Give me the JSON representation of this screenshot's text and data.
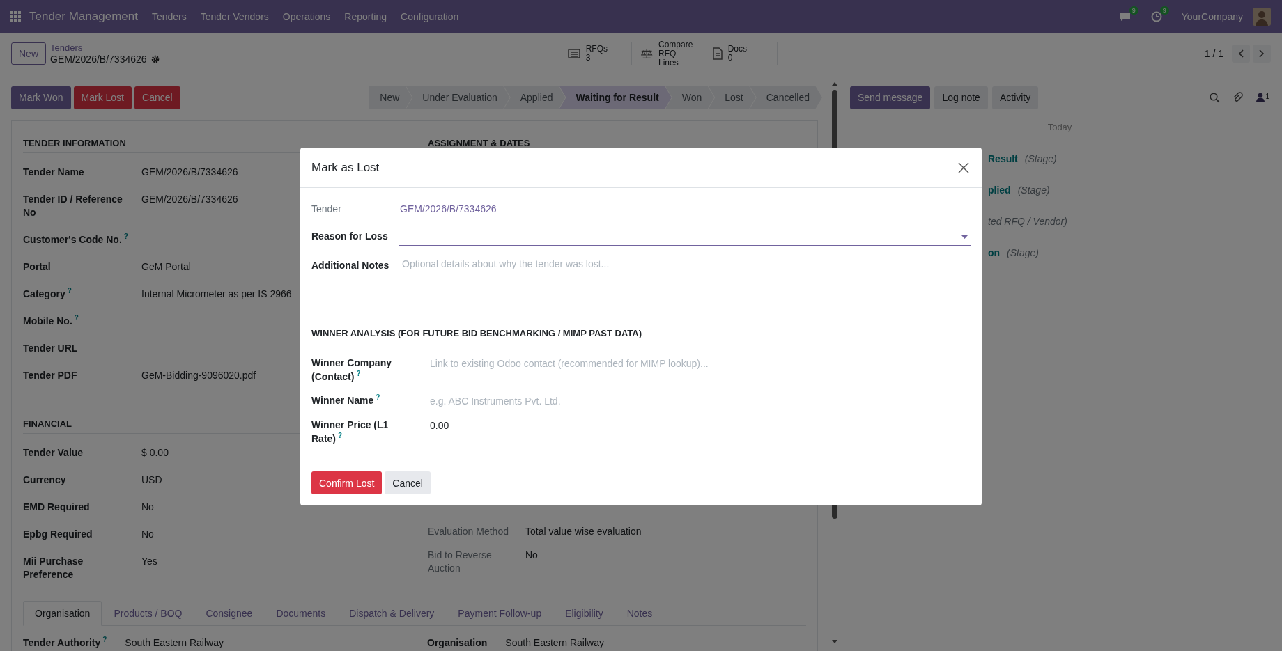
{
  "navbar": {
    "app": "Tender Management",
    "menus": [
      "Tenders",
      "Tender Vendors",
      "Operations",
      "Reporting",
      "Configuration"
    ],
    "chat_count": "9",
    "activity_count": "9",
    "company": "YourCompany"
  },
  "control_panel": {
    "new_button": "New",
    "breadcrumb": "Tenders",
    "record": "GEM/2026/B/7334626",
    "pager": "1 / 1",
    "smart_buttons": [
      {
        "kind": "list",
        "label": "RFQs",
        "value": "3"
      },
      {
        "kind": "scale",
        "label": "Compare",
        "value": "RFQ Lines"
      },
      {
        "kind": "doc",
        "label": "Docs",
        "value": "0"
      }
    ]
  },
  "actions": [
    {
      "label": "Mark Won",
      "kind": "primary"
    },
    {
      "label": "Mark Lost",
      "kind": "danger"
    },
    {
      "label": "Cancel",
      "kind": "danger"
    }
  ],
  "statusbar": [
    {
      "label": "New",
      "selected": false
    },
    {
      "label": "Under Evaluation",
      "selected": false
    },
    {
      "label": "Applied",
      "selected": false
    },
    {
      "label": "Waiting for Result",
      "selected": true
    },
    {
      "label": "Won",
      "selected": false
    },
    {
      "label": "Lost",
      "selected": false
    },
    {
      "label": "Cancelled",
      "selected": false
    }
  ],
  "form": {
    "sections": [
      {
        "title": "TENDER INFORMATION",
        "fields": [
          {
            "label": "Tender Name",
            "value": "GEM/2026/B/7334626"
          },
          {
            "label": "Tender ID / Reference No",
            "value": "GEM/2026/B/7334626"
          },
          {
            "label": "Customer's Code No.",
            "help": "?"
          },
          {
            "label": "Portal",
            "value": "GeM Portal"
          },
          {
            "label": "Category",
            "help": "?",
            "value": "Internal Micrometer as per IS 2966"
          },
          {
            "label": "Mobile No.",
            "help": "?"
          },
          {
            "label": "Tender URL"
          },
          {
            "label": "Tender PDF",
            "value": "GeM-Bidding-9096020.pdf"
          }
        ]
      },
      {
        "title": "FINANCIAL",
        "fields": [
          {
            "label": "Tender Value",
            "value": "$ 0.00"
          },
          {
            "label": "Currency",
            "value": "USD"
          },
          {
            "label": "EMD Required",
            "value": "No"
          },
          {
            "label": "Epbg Required",
            "value": "No"
          },
          {
            "label": "Mii Purchase Preference",
            "value": "Yes"
          }
        ]
      }
    ],
    "right_section": {
      "title": "ASSIGNMENT & DATES",
      "fields": [
        {
          "label": "Evaluation Method",
          "value": "Total value wise evaluation"
        },
        {
          "label": "Bid to Reverse Auction",
          "value": "No"
        }
      ]
    },
    "tabs": [
      {
        "label": "Organisation",
        "selected": true
      },
      {
        "label": "Products / BOQ",
        "selected": false
      },
      {
        "label": "Consignee",
        "selected": false
      },
      {
        "label": "Documents",
        "selected": false
      },
      {
        "label": "Dispatch & Delivery",
        "selected": false
      },
      {
        "label": "Payment Follow-up",
        "selected": false
      },
      {
        "label": "Eligibility",
        "selected": false
      },
      {
        "label": "Notes",
        "selected": false
      }
    ],
    "tab_fields": [
      {
        "label": "Tender Authority",
        "help": "?",
        "value": "South Eastern Railway"
      },
      {
        "label": "Organisation",
        "value": "South Eastern Railway"
      }
    ]
  },
  "chatter": {
    "buttons": [
      {
        "label": "Send message",
        "kind": "primary"
      },
      {
        "label": "Log note",
        "kind": "secondary"
      },
      {
        "label": "Activity",
        "kind": "secondary"
      }
    ],
    "followers": "1",
    "date_separator": "Today",
    "messages": [
      {
        "link": "Result",
        "note": "(Stage)"
      },
      {
        "link": "plied",
        "note": "(Stage)"
      },
      {
        "note": "ted RFQ / Vendor)"
      },
      {
        "link": "on",
        "note": "(Stage)"
      }
    ]
  },
  "dialog": {
    "title": "Mark as Lost",
    "fields": [
      {
        "kind": "link",
        "label": "Tender",
        "value": "GEM/2026/B/7334626"
      },
      {
        "kind": "select",
        "label": "Reason for Loss"
      },
      {
        "kind": "textarea",
        "label": "Additional Notes",
        "placeholder": "Optional details about why the tender was lost..."
      }
    ],
    "section": "WINNER ANALYSIS (FOR FUTURE BID BENCHMARKING / MIMP PAST DATA)",
    "winner_fields": [
      {
        "kind": "input",
        "label": "Winner Company (Contact)",
        "help": "?",
        "placeholder": "Link to existing Odoo contact (recommended for MIMP lookup)..."
      },
      {
        "kind": "input",
        "label": "Winner Name",
        "help": "?",
        "placeholder": "e.g. ABC Instruments Pvt. Ltd."
      },
      {
        "kind": "input",
        "label": "Winner Price (L1 Rate)",
        "help": "?",
        "value": "0.00"
      }
    ],
    "buttons": [
      {
        "label": "Confirm Lost",
        "kind": "danger"
      },
      {
        "label": "Cancel",
        "kind": "secondary"
      }
    ]
  }
}
